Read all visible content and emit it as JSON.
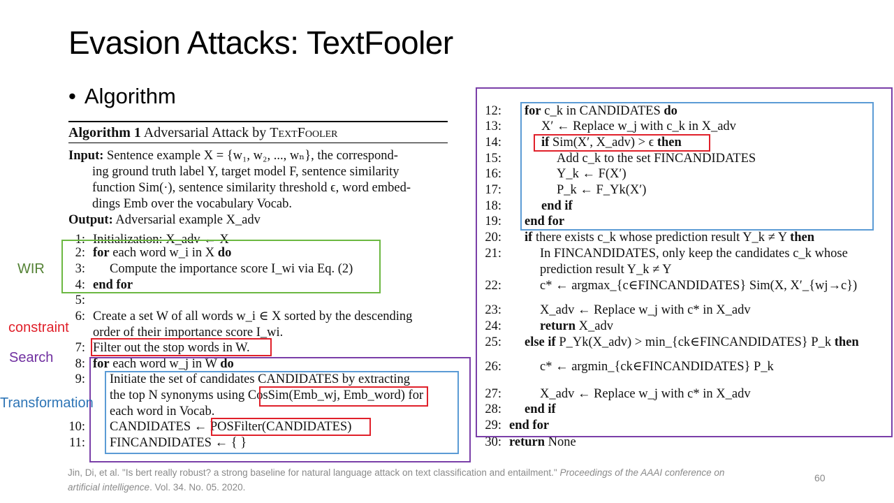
{
  "slide": {
    "title": "Evasion Attacks: TextFooler",
    "bullet": "Algorithm",
    "page_number": "60"
  },
  "labels": {
    "wir": "WIR",
    "constraint": "constraint",
    "search": "Search",
    "transformation": "Transformation"
  },
  "colors": {
    "wir": "#548235",
    "constraint": "#e0202a",
    "search": "#7030a0",
    "transformation": "#2e75b6",
    "green_box": "#6cb842",
    "purple_box": "#7a3fa8",
    "blue_box": "#5b9bd5",
    "red_box": "#e0202a"
  },
  "algorithm": {
    "header_bold": "Algorithm 1",
    "header_rest": "Adversarial Attack by TextFooler",
    "input_label": "Input:",
    "input_text": "Sentence example X = {w1, w2, ..., wn}, the corresponding ground truth label Y, target model F, sentence similarity function Sim(·), sentence similarity threshold ϵ, word embeddings Emb over the vocabulary Vocab.",
    "input_lines": [
      "Sentence example X = {w₁, w₂, ..., wₙ}, the correspond-",
      "ing ground truth label Y, target model F, sentence similarity",
      "function Sim(·), sentence similarity threshold ϵ, word embed-",
      "dings Emb over the vocabulary Vocab."
    ],
    "output_label": "Output:",
    "output_text": "Adversarial example X_adv",
    "lines": [
      {
        "n": "1:",
        "text": "Initialization: X_adv ← X"
      },
      {
        "n": "2:",
        "text": "for each word w_i in X do"
      },
      {
        "n": "3:",
        "text": "Compute the importance score I_wi via Eq. (2)"
      },
      {
        "n": "4:",
        "text": "end for"
      },
      {
        "n": "5:",
        "text": ""
      },
      {
        "n": "6:",
        "text": "Create a set W of all words w_i ∈ X sorted by the descending"
      },
      {
        "n": "",
        "text": "order of their importance score I_wi."
      },
      {
        "n": "7:",
        "text": "Filter out the stop words in W."
      },
      {
        "n": "8:",
        "text": "for each word w_j in W do"
      },
      {
        "n": "9:",
        "text": "Initiate the set of candidates CANDIDATES by extracting"
      },
      {
        "n": "",
        "text": "the top N synonyms using CosSim(Emb_wj, Emb_word) for"
      },
      {
        "n": "",
        "text": "each word in Vocab."
      },
      {
        "n": "10:",
        "text": "CANDIDATES ← POSFilter(CANDIDATES)"
      },
      {
        "n": "11:",
        "text": "FINCANDIDATES ← { }"
      },
      {
        "n": "12:",
        "text": "for c_k in CANDIDATES do"
      },
      {
        "n": "13:",
        "text": "X′ ← Replace w_j with c_k in X_adv"
      },
      {
        "n": "14:",
        "text": "if Sim(X′, X_adv) > ϵ then"
      },
      {
        "n": "15:",
        "text": "Add c_k to the set FINCANDIDATES"
      },
      {
        "n": "16:",
        "text": "Y_k ← F(X′)"
      },
      {
        "n": "17:",
        "text": "P_k ← F_Yk(X′)"
      },
      {
        "n": "18:",
        "text": "end if"
      },
      {
        "n": "19:",
        "text": "end for"
      },
      {
        "n": "20:",
        "text": "if there exists c_k whose prediction result Y_k ≠ Y then"
      },
      {
        "n": "21:",
        "text": "In FINCANDIDATES, only keep the candidates c_k whose"
      },
      {
        "n": "",
        "text": "prediction result Y_k ≠ Y"
      },
      {
        "n": "22:",
        "text": "c* ← argmax_{c∈FINCANDIDATES} Sim(X, X′_{wj→c})"
      },
      {
        "n": "23:",
        "text": "X_adv ← Replace w_j with c* in X_adv"
      },
      {
        "n": "24:",
        "text": "return X_adv"
      },
      {
        "n": "25:",
        "text": "else if P_Yk(X_adv) > min_{ck∈FINCANDIDATES} P_k then"
      },
      {
        "n": "26:",
        "text": "c* ← argmin_{ck∈FINCANDIDATES} P_k"
      },
      {
        "n": "27:",
        "text": "X_adv ← Replace w_j with c* in X_adv"
      },
      {
        "n": "28:",
        "text": "end if"
      },
      {
        "n": "29:",
        "text": "end for"
      },
      {
        "n": "30:",
        "text": "return None"
      }
    ]
  },
  "citation": {
    "text": "Jin, Di, et al. \"Is bert really robust? a strong baseline for natural language attack on text classification and entailment.\"",
    "journal": "Proceedings of the AAAI conference on artificial intelligence",
    "rest": ". Vol. 34. No. 05. 2020."
  }
}
